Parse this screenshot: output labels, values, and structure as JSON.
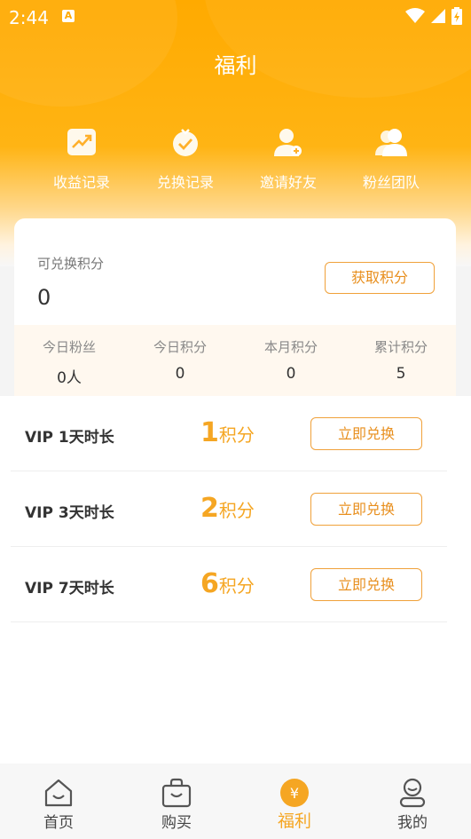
{
  "status_bar": {
    "time": "2:44",
    "badge": "A"
  },
  "page": {
    "title": "福利"
  },
  "quick_actions": [
    {
      "label": "收益记录",
      "icon": "trend-chart-icon"
    },
    {
      "label": "兑换记录",
      "icon": "check-badge-icon"
    },
    {
      "label": "邀请好友",
      "icon": "add-user-icon"
    },
    {
      "label": "粉丝团队",
      "icon": "team-icon"
    }
  ],
  "points": {
    "available_label": "可兑换积分",
    "available_value": "0",
    "get_button": "获取积分"
  },
  "stats": [
    {
      "label": "今日粉丝",
      "value": "0人"
    },
    {
      "label": "今日积分",
      "value": "0"
    },
    {
      "label": "本月积分",
      "value": "0"
    },
    {
      "label": "累计积分",
      "value": "5"
    }
  ],
  "exchange_items": [
    {
      "name": "VIP 1天时长",
      "points": "1",
      "unit": "积分",
      "button": "立即兑换"
    },
    {
      "name": "VIP 3天时长",
      "points": "2",
      "unit": "积分",
      "button": "立即兑换"
    },
    {
      "name": "VIP 7天时长",
      "points": "6",
      "unit": "积分",
      "button": "立即兑换"
    }
  ],
  "tabs": [
    {
      "label": "首页",
      "icon": "home-icon",
      "active": false
    },
    {
      "label": "购买",
      "icon": "shopping-bag-icon",
      "active": false
    },
    {
      "label": "福利",
      "icon": "yen-coin-icon",
      "active": true
    },
    {
      "label": "我的",
      "icon": "profile-icon",
      "active": false
    }
  ],
  "colors": {
    "accent": "#f5a623",
    "header": "#ffaa00",
    "button_border": "#f0a13a"
  }
}
